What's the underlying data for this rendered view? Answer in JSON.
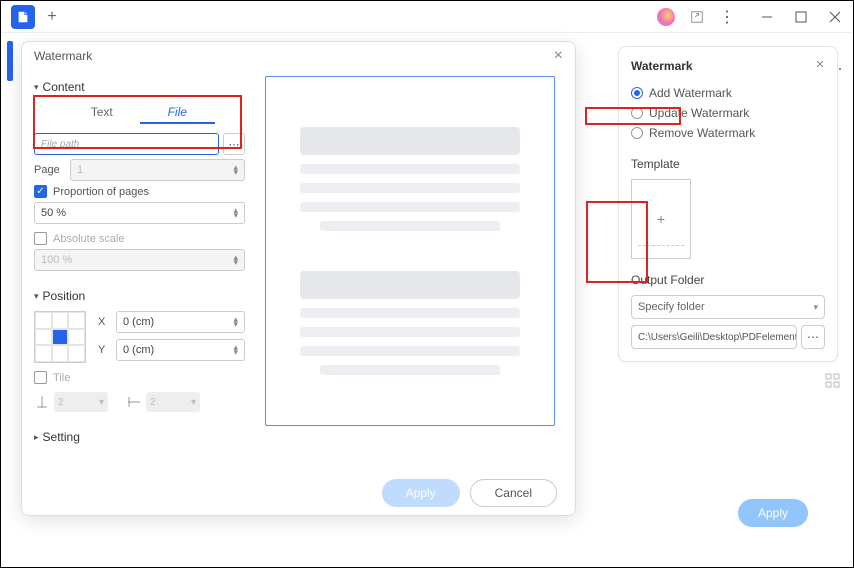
{
  "dialog": {
    "title": "Watermark",
    "content_section": "Content",
    "tabs": {
      "text": "Text",
      "file": "File"
    },
    "file_placeholder": "File path",
    "page_label": "Page",
    "page_value": "1",
    "proportion_label": "Proportion of pages",
    "proportion_value": "50 %",
    "absolute_label": "Absolute scale",
    "absolute_value": "100 %",
    "position_section": "Position",
    "x_label": "X",
    "x_value": "0 (cm)",
    "y_label": "Y",
    "y_value": "0 (cm)",
    "tile_label": "Tile",
    "tile_a": "2",
    "tile_b": "2",
    "setting_section": "Setting",
    "apply_label": "Apply",
    "cancel_label": "Cancel"
  },
  "right_panel": {
    "header": "Watermark",
    "radio": {
      "add": "Add Watermark",
      "update": "Update Watermark",
      "remove": "Remove Watermark"
    },
    "template_section": "Template",
    "output_section": "Output Folder",
    "specify_label": "Specify folder",
    "output_path": "C:\\Users\\Geili\\Desktop\\PDFelement\\W..."
  },
  "footer_apply": "Apply"
}
